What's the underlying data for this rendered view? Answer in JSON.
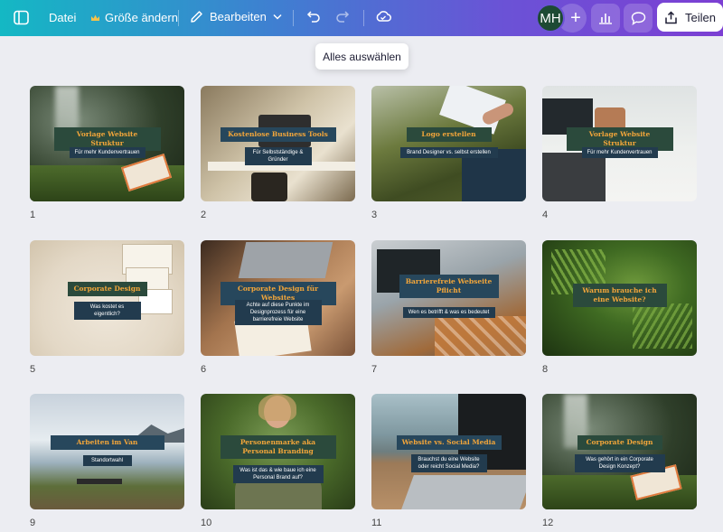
{
  "toolbar": {
    "file_label": "Datei",
    "resize_label": "Größe ändern",
    "edit_label": "Bearbeiten",
    "share_label": "Teilen",
    "avatar_initials": "MH"
  },
  "tooltip": {
    "text": "Alles auswählen"
  },
  "pages": [
    {
      "number": "1",
      "title": "Vorlage Website Struktur",
      "subtitle": "Für mehr Kundenvertrauen"
    },
    {
      "number": "2",
      "title": "Kostenlose Business Tools",
      "subtitle": "Für Selbstständige & Gründer"
    },
    {
      "number": "3",
      "title": "Logo erstellen",
      "subtitle": "Brand Designer vs. selbst erstellen"
    },
    {
      "number": "4",
      "title": "Vorlage Website Struktur",
      "subtitle": "Für mehr Kundenvertrauen"
    },
    {
      "number": "5",
      "title": "Corporate Design",
      "subtitle": "Was kostet es eigentlich?"
    },
    {
      "number": "6",
      "title": "Corporate Design für Websites",
      "subtitle": "Achte auf diese Punkte im Designprozess für eine barrierefreie Website"
    },
    {
      "number": "7",
      "title": "Barrierefreie Webseite Pflicht",
      "subtitle": "Wen es betrifft & was es bedeutet"
    },
    {
      "number": "8",
      "title": "Warum brauche ich eine Website?",
      "subtitle": ""
    },
    {
      "number": "9",
      "title": "Arbeiten im Van",
      "subtitle": "Standortwahl"
    },
    {
      "number": "10",
      "title": "Personenmarke aka Personal Branding",
      "subtitle": "Was ist das & wie baue ich eine Personal Brand auf?"
    },
    {
      "number": "11",
      "title": "Website vs. Social Media",
      "subtitle": "Brauchst du eine Website oder reicht Social Media?"
    },
    {
      "number": "12",
      "title": "Corporate Design",
      "subtitle": "Was gehört in ein Corporate Design Konzept?"
    }
  ]
}
